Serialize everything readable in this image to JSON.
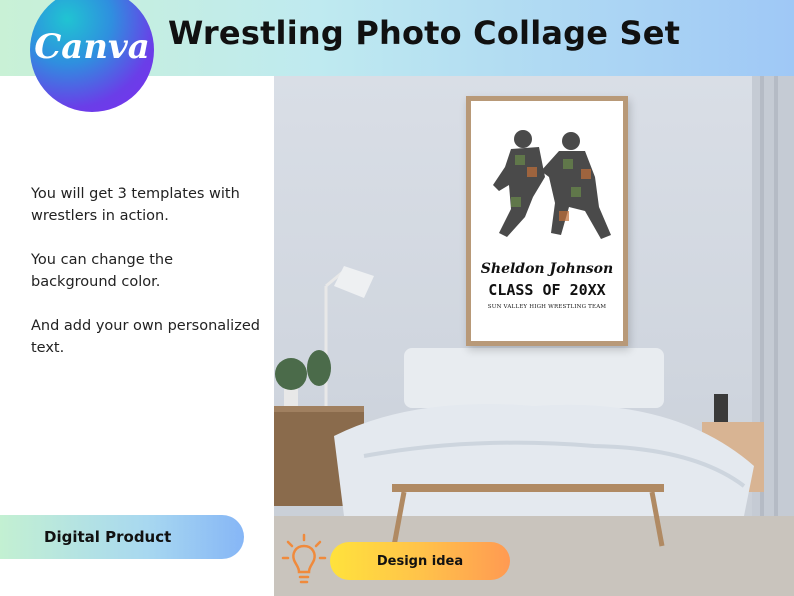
{
  "brand": {
    "logo_text": "Canva"
  },
  "header": {
    "title": "Wrestling Photo Collage Set"
  },
  "description": [
    "You will get 3 templates with wrestlers in action.",
    "You can change the background color.",
    "And add your own personalized text."
  ],
  "badge": {
    "label": "Digital Product"
  },
  "poster": {
    "name": "Sheldon Johnson",
    "class_line": "CLASS OF 20XX",
    "team": "SUN VALLEY HIGH WRESTLING TEAM"
  },
  "cta": {
    "label": "Design idea"
  },
  "colors": {
    "header_gradient": [
      "#c9f1d6",
      "#9fc8f6"
    ],
    "cta_gradient": [
      "#ffe23c",
      "#ff9a52"
    ],
    "frame": "#b89978"
  }
}
